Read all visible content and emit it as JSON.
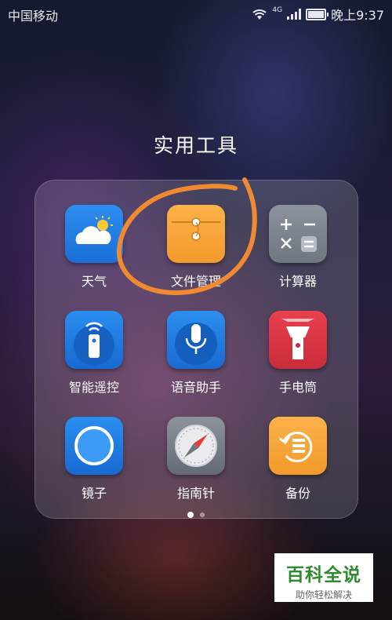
{
  "status_bar": {
    "carrier": "中国移动",
    "network": "4G",
    "time": "晚上9:37",
    "battery_level": 0.9
  },
  "folder": {
    "title": "实用工具",
    "apps": [
      {
        "label": "天气",
        "icon": "weather-icon"
      },
      {
        "label": "文件管理",
        "icon": "file-manager-icon"
      },
      {
        "label": "计算器",
        "icon": "calculator-icon"
      },
      {
        "label": "智能遥控",
        "icon": "smart-remote-icon"
      },
      {
        "label": "语音助手",
        "icon": "voice-assistant-icon"
      },
      {
        "label": "手电筒",
        "icon": "flashlight-icon"
      },
      {
        "label": "镜子",
        "icon": "mirror-icon"
      },
      {
        "label": "指南针",
        "icon": "compass-icon"
      },
      {
        "label": "备份",
        "icon": "backup-icon"
      }
    ],
    "page_count": 2,
    "current_page": 1
  },
  "annotation": {
    "circled_app": "文件管理",
    "color": "#f08a30"
  },
  "watermark": {
    "brand": "百科全说",
    "slogan": "助你轻松解决"
  }
}
